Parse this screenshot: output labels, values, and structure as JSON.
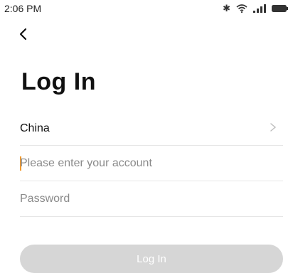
{
  "status_bar": {
    "time": "2:06 PM",
    "icons": [
      "bluetooth-icon",
      "wifi-icon",
      "signal-icon",
      "battery-icon"
    ]
  },
  "nav": {
    "back_icon": "back-arrow-icon"
  },
  "title": "Log In",
  "form": {
    "country": {
      "value": "China",
      "icon": "chevron-right-icon"
    },
    "account": {
      "placeholder": "Please enter your account",
      "value": ""
    },
    "password": {
      "placeholder": "Password",
      "value": ""
    },
    "login_button": {
      "label": "Log In"
    }
  },
  "colors": {
    "button_disabled_bg": "#d6d6d6",
    "caret": "#f29a2e",
    "divider": "#e6e6e6"
  }
}
